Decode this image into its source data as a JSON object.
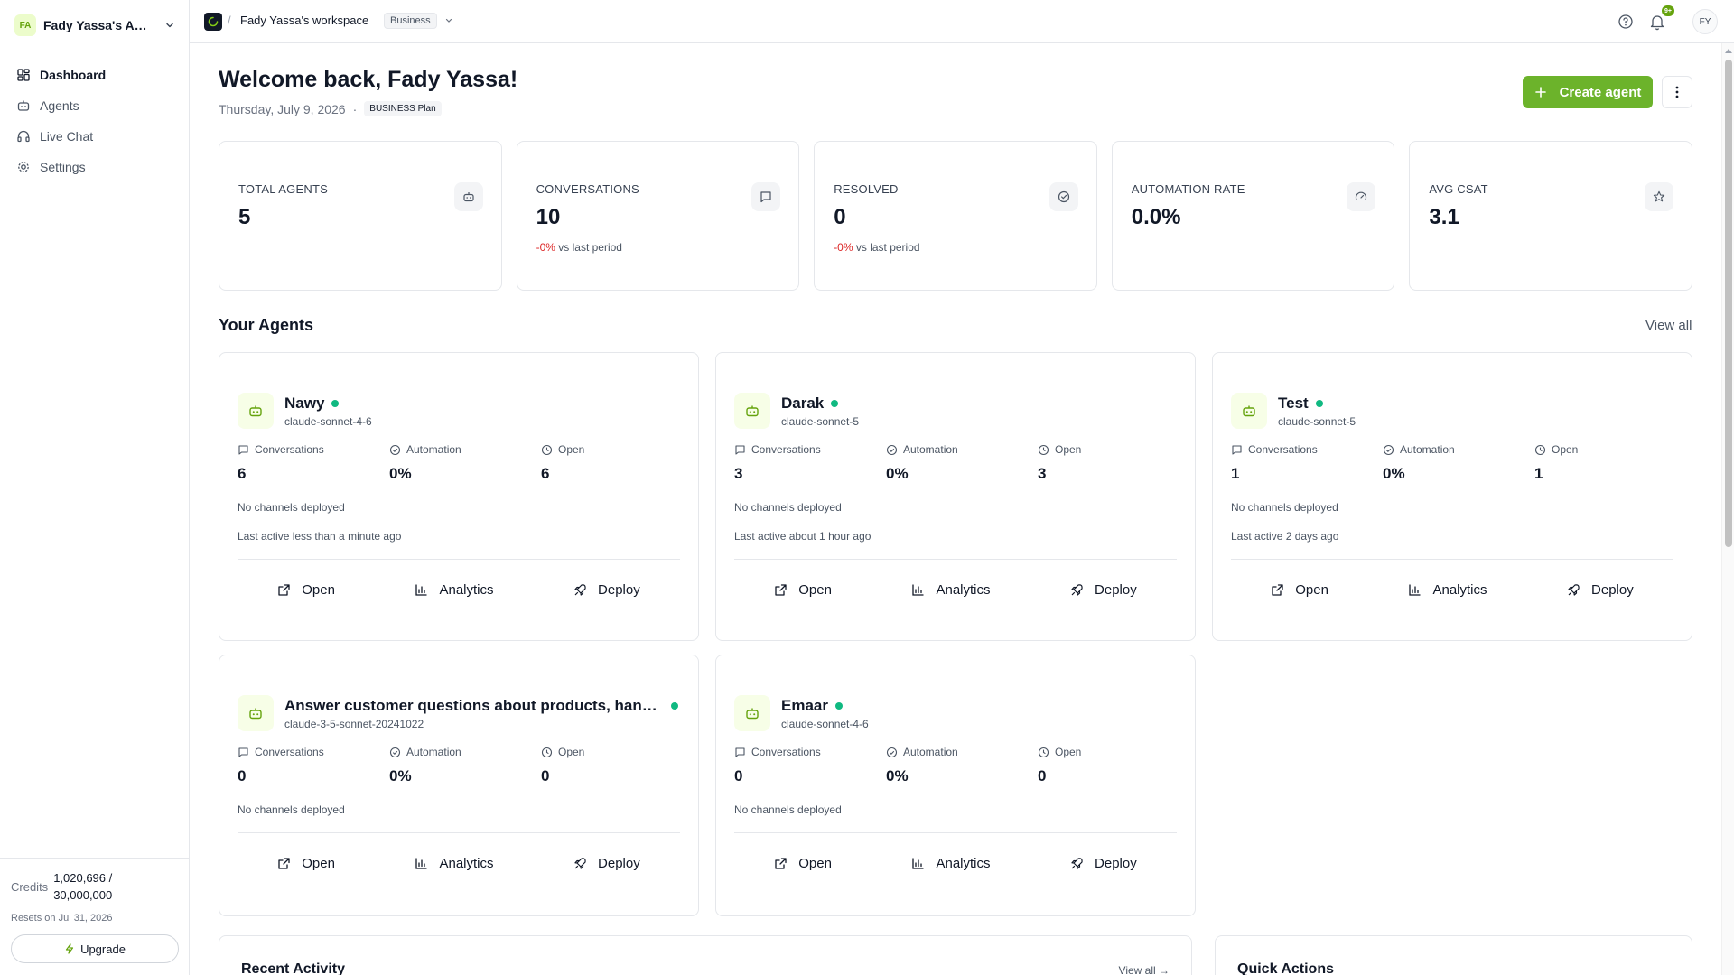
{
  "sidebar": {
    "account_initials": "FA",
    "account_name": "Fady Yassa's Acc...",
    "nav": [
      {
        "label": "Dashboard",
        "icon": "dashboard-icon",
        "active": true
      },
      {
        "label": "Agents",
        "icon": "bot-icon",
        "active": false
      },
      {
        "label": "Live Chat",
        "icon": "headset-icon",
        "active": false
      },
      {
        "label": "Settings",
        "icon": "gear-icon",
        "active": false
      }
    ],
    "credits_label": "Credits",
    "credits_used": "1,020,696 /",
    "credits_total": "30,000,000",
    "credits_reset": "Resets on Jul 31, 2026",
    "upgrade_label": "Upgrade"
  },
  "topbar": {
    "separator": "/",
    "workspace_name": "Fady Yassa's workspace",
    "workspace_plan": "Business",
    "notification_badge": "9+",
    "user_initials": "FY"
  },
  "header": {
    "welcome": "Welcome back, Fady Yassa!",
    "date": "Thursday, July 9, 2026",
    "dot": "·",
    "plan_badge": "BUSINESS Plan",
    "create_agent_label": "Create agent"
  },
  "stats": [
    {
      "label": "TOTAL AGENTS",
      "value": "5",
      "delta": "",
      "delta_suffix": "",
      "icon": "bot-icon"
    },
    {
      "label": "CONVERSATIONS",
      "value": "10",
      "delta": "-0%",
      "delta_suffix": " vs last period",
      "icon": "chat-icon"
    },
    {
      "label": "RESOLVED",
      "value": "0",
      "delta": "-0%",
      "delta_suffix": " vs last period",
      "icon": "check-circle-icon"
    },
    {
      "label": "AUTOMATION RATE",
      "value": "0.0%",
      "delta": "",
      "delta_suffix": "",
      "icon": "gauge-icon"
    },
    {
      "label": "AVG CSAT",
      "value": "3.1",
      "delta": "",
      "delta_suffix": "",
      "icon": "star-icon"
    }
  ],
  "agents_section": {
    "title": "Your Agents",
    "view_all": "View all",
    "metric_labels": {
      "conversations": "Conversations",
      "automation": "Automation",
      "open": "Open"
    },
    "action_labels": {
      "open": "Open",
      "analytics": "Analytics",
      "deploy": "Deploy"
    },
    "agents": [
      {
        "name": "Nawy",
        "model": "claude-sonnet-4-6",
        "conversations": "6",
        "automation": "0%",
        "open": "6",
        "channels": "No channels deployed",
        "last_active": "Last active less than a minute ago"
      },
      {
        "name": "Darak",
        "model": "claude-sonnet-5",
        "conversations": "3",
        "automation": "0%",
        "open": "3",
        "channels": "No channels deployed",
        "last_active": "Last active about 1 hour ago"
      },
      {
        "name": "Test",
        "model": "claude-sonnet-5",
        "conversations": "1",
        "automation": "0%",
        "open": "1",
        "channels": "No channels deployed",
        "last_active": "Last active 2 days ago"
      },
      {
        "name": "Answer customer questions about products, handle ...",
        "model": "claude-3-5-sonnet-20241022",
        "conversations": "0",
        "automation": "0%",
        "open": "0",
        "channels": "No channels deployed",
        "last_active": ""
      },
      {
        "name": "Emaar",
        "model": "claude-sonnet-4-6",
        "conversations": "0",
        "automation": "0%",
        "open": "0",
        "channels": "No channels deployed",
        "last_active": ""
      }
    ]
  },
  "recent_activity": {
    "title": "Recent Activity",
    "view_all": "View all →"
  },
  "quick_actions": {
    "title": "Quick Actions"
  },
  "colors": {
    "accent": "#6cb32b",
    "status_active": "#10b981",
    "negative": "#dc2626"
  }
}
